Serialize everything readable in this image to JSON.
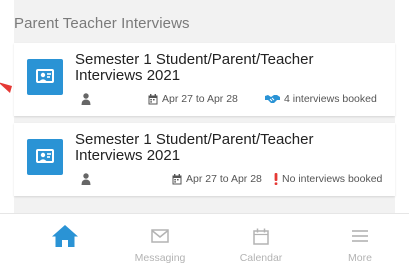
{
  "section": {
    "title": "Parent Teacher Interviews"
  },
  "cards": [
    {
      "title": "Semester 1 Student/Parent/Teacher Interviews 2021",
      "dates": "Apr 27 to Apr 28",
      "booked": "4 interviews booked",
      "booked_icon": "handshake-icon"
    },
    {
      "title": "Semester 1 Student/Parent/Teacher Interviews 2021",
      "dates": "Apr 27 to Apr 28",
      "booked": "No interviews booked",
      "booked_icon": "exclamation-icon"
    }
  ],
  "tabs": [
    {
      "label": "",
      "icon": "home-icon",
      "active": true
    },
    {
      "label": "Messaging",
      "icon": "envelope-icon"
    },
    {
      "label": "Calendar",
      "icon": "calendar-icon"
    },
    {
      "label": "More",
      "icon": "menu-icon"
    }
  ],
  "colors": {
    "accent": "#2a93d5",
    "warning": "#e53935",
    "annotation_arrow": "#e53935",
    "muted": "#b3b3b3"
  }
}
